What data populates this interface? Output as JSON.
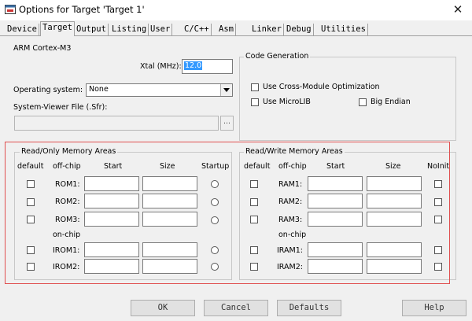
{
  "window": {
    "title": "Options for Target 'Target 1'",
    "close_glyph": "✕",
    "app_icon": "window-app-icon"
  },
  "tabs": [
    {
      "label": "Device"
    },
    {
      "label": "Target"
    },
    {
      "label": "Output"
    },
    {
      "label": "Listing"
    },
    {
      "label": "User"
    },
    {
      "label": "C/C++"
    },
    {
      "label": "Asm"
    },
    {
      "label": "Linker"
    },
    {
      "label": "Debug"
    },
    {
      "label": "Utilities"
    }
  ],
  "target": {
    "device": "ARM Cortex-M3",
    "xtal_label": "Xtal (MHz):",
    "xtal_value": "12.0",
    "os_label": "Operating system:",
    "os_value": "None",
    "sfr_label": "System-Viewer File (.Sfr):",
    "browse_label": "..."
  },
  "codegen": {
    "title": "Code Generation",
    "cross_module": "Use Cross-Module Optimization",
    "microlib": "Use MicroLIB",
    "big_endian": "Big Endian"
  },
  "ro": {
    "title": "Read/Only Memory Areas",
    "headers": {
      "default": "default",
      "offchip": "off-chip",
      "start": "Start",
      "size": "Size",
      "startup": "Startup"
    },
    "onchip": "on-chip",
    "rows": [
      "ROM1:",
      "ROM2:",
      "ROM3:",
      "IROM1:",
      "IROM2:"
    ]
  },
  "rw": {
    "title": "Read/Write Memory Areas",
    "headers": {
      "default": "default",
      "offchip": "off-chip",
      "start": "Start",
      "size": "Size",
      "noinit": "NoInit"
    },
    "onchip": "on-chip",
    "rows": [
      "RAM1:",
      "RAM2:",
      "RAM3:",
      "IRAM1:",
      "IRAM2:"
    ]
  },
  "buttons": {
    "ok": "OK",
    "cancel": "Cancel",
    "defaults": "Defaults",
    "help": "Help"
  },
  "colors": {
    "highlight": "#3399ff",
    "annotation_box": "#e05050"
  }
}
